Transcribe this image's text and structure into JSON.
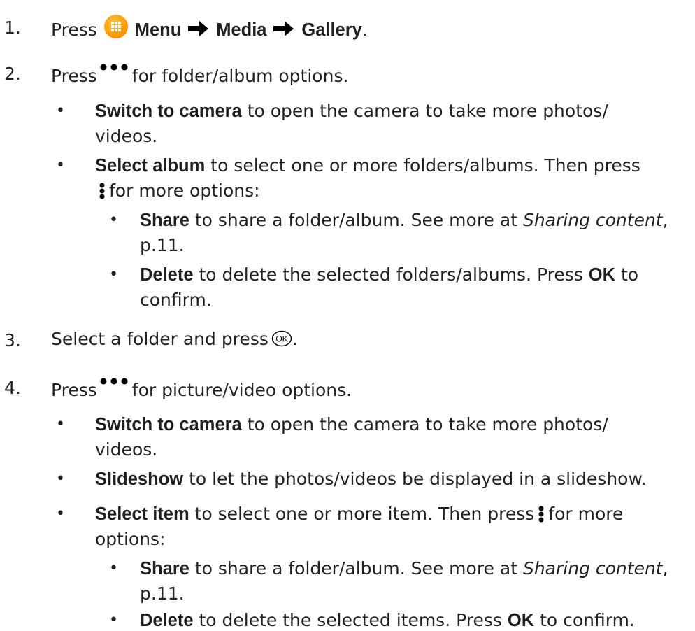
{
  "step1": {
    "num": "1.",
    "press": "Press",
    "menu": "Menu",
    "media": "Media",
    "gallery": "Gallery",
    "period": "."
  },
  "step2": {
    "num": "2.",
    "press": "Press",
    "text": "for folder/album options."
  },
  "s2b1": {
    "bold": "Switch to camera",
    "text1": "to open the camera to take more photos/",
    "text2": "videos."
  },
  "s2b2": {
    "bold": "Select album",
    "text1": "to select one or more folders/albums. Then press",
    "text2": "for more options:"
  },
  "s2b2a": {
    "bold": "Share",
    "text1": "to share a folder/album. See more at",
    "italic": "Sharing content",
    "comma": ",",
    "text2": "p.11."
  },
  "s2b2b": {
    "bold": "Delete",
    "text1": "to delete the selected folders/albums. Press",
    "ok": "OK",
    "text1b": "to",
    "text2": "confirm."
  },
  "step3": {
    "num": "3.",
    "text": "Select a folder and press",
    "period": "."
  },
  "step4": {
    "num": "4.",
    "press": "Press",
    "text": "for picture/video options."
  },
  "s4b1": {
    "bold": "Switch to camera",
    "text1": "to open the camera to take more photos/",
    "text2": "videos."
  },
  "s4b2": {
    "bold": "Slideshow",
    "text1": "to let the photos/videos be displayed in a slideshow."
  },
  "s4b3": {
    "bold": "Select item",
    "text1": "to select one or more item. Then press",
    "text1b": "for more",
    "text2": "options:"
  },
  "s4b3a": {
    "bold": "Share",
    "text1": "to share a folder/album. See more at",
    "italic": "Sharing content",
    "comma": ",",
    "text2": "p.11."
  },
  "s4b3b": {
    "bold": "Delete",
    "text1": "to delete the selected items. Press",
    "ok": "OK",
    "text1b": "to confirm."
  },
  "bullet": "•",
  "icons": {
    "menu": "menu-grid-icon",
    "arrow": "right-arrow-icon",
    "options": "more-options-dots-icon",
    "vertical": "vertical-dots-icon",
    "ok": "ok-key-icon"
  },
  "colors": {
    "text": "#231f20",
    "menu_icon": "#ff9b00"
  }
}
